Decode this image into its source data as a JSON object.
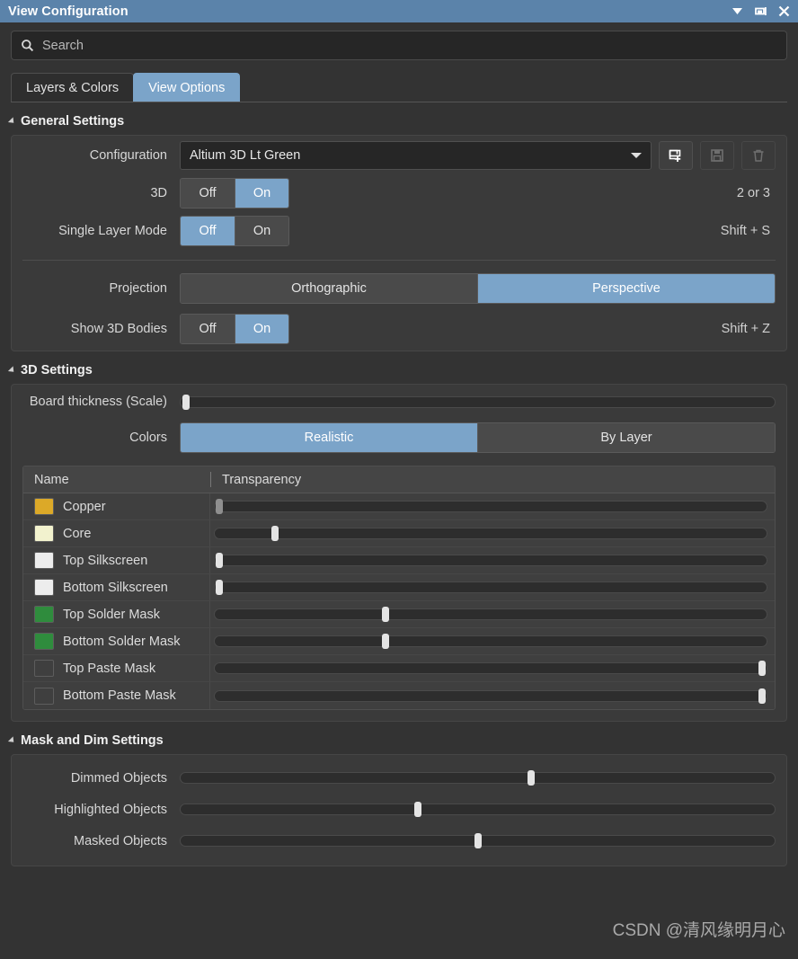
{
  "window": {
    "title": "View Configuration",
    "accent_color": "#5b83aa",
    "background_color": "#333333",
    "controls": [
      {
        "name": "menu-dropdown",
        "icon": "chevron-down-icon"
      },
      {
        "name": "dock-pin",
        "icon": "pin-icon"
      },
      {
        "name": "close",
        "icon": "close-icon"
      }
    ]
  },
  "search": {
    "placeholder": "Search",
    "value": "",
    "icon": "search-icon"
  },
  "tabs": [
    {
      "label": "Layers & Colors",
      "active": false
    },
    {
      "label": "View Options",
      "active": true
    }
  ],
  "sections": {
    "general": {
      "title": "General Settings",
      "expanded": true,
      "configuration": {
        "label": "Configuration",
        "value": "Altium 3D Lt Green",
        "buttons": [
          {
            "name": "new-configuration",
            "icon": "add-config-icon",
            "enabled": true
          },
          {
            "name": "save-configuration",
            "icon": "save-icon",
            "enabled": false
          },
          {
            "name": "delete-configuration",
            "icon": "trash-icon",
            "enabled": false
          }
        ]
      },
      "three_d": {
        "label": "3D",
        "options": [
          "Off",
          "On"
        ],
        "selected": "On",
        "shortcut": "2 or 3"
      },
      "single_layer_mode": {
        "label": "Single Layer Mode",
        "options": [
          "Off",
          "On"
        ],
        "selected": "Off",
        "shortcut": "Shift + S"
      },
      "projection": {
        "label": "Projection",
        "options": [
          "Orthographic",
          "Perspective"
        ],
        "selected": "Perspective"
      },
      "show_3d_bodies": {
        "label": "Show 3D Bodies",
        "options": [
          "Off",
          "On"
        ],
        "selected": "On",
        "shortcut": "Shift + Z"
      }
    },
    "three_d_settings": {
      "title": "3D Settings",
      "expanded": true,
      "board_thickness": {
        "label": "Board thickness (Scale)",
        "value": 1
      },
      "colors": {
        "label": "Colors",
        "options": [
          "Realistic",
          "By Layer"
        ],
        "selected": "Realistic"
      },
      "table": {
        "columns": [
          "Name",
          "Transparency"
        ],
        "rows": [
          {
            "name": "Copper",
            "color": "#dca928",
            "transparency": 1,
            "thumb_dim": true
          },
          {
            "name": "Core",
            "color": "#f2f2ce",
            "transparency": 11,
            "thumb_dim": false
          },
          {
            "name": "Top Silkscreen",
            "color": "#ededed",
            "transparency": 1,
            "thumb_dim": false
          },
          {
            "name": "Bottom Silkscreen",
            "color": "#ededed",
            "transparency": 1,
            "thumb_dim": false
          },
          {
            "name": "Top Solder Mask",
            "color": "#2f8c3d",
            "transparency": 31,
            "thumb_dim": false
          },
          {
            "name": "Bottom Solder Mask",
            "color": "#2f8c3d",
            "transparency": 31,
            "thumb_dim": false
          },
          {
            "name": "Top Paste Mask",
            "color": "none",
            "transparency": 99,
            "thumb_dim": false
          },
          {
            "name": "Bottom Paste Mask",
            "color": "none",
            "transparency": 99,
            "thumb_dim": false
          }
        ]
      }
    },
    "mask_and_dim": {
      "title": "Mask and Dim Settings",
      "expanded": true,
      "sliders": [
        {
          "label": "Dimmed Objects",
          "value": 59
        },
        {
          "label": "Highlighted Objects",
          "value": 40
        },
        {
          "label": "Masked Objects",
          "value": 50
        }
      ]
    }
  },
  "watermark": "CSDN @清风缘明月心"
}
